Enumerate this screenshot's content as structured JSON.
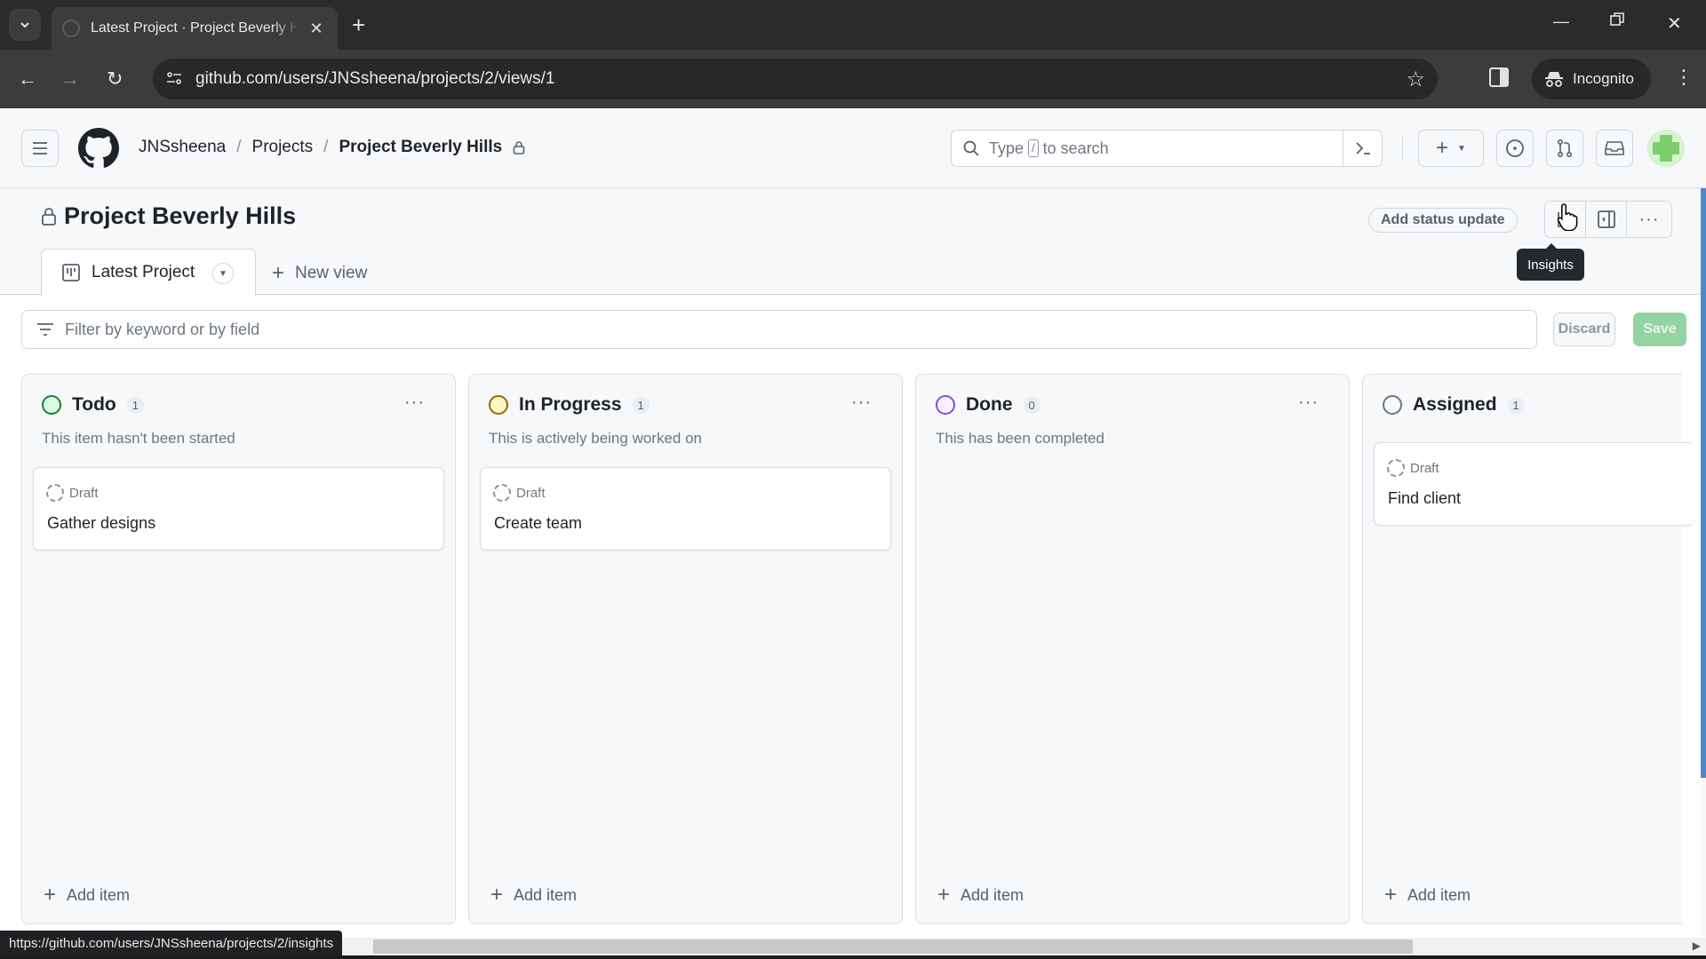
{
  "browser": {
    "tab_title": "Latest Project · Project Beverly Hills",
    "url": "github.com/users/JNSsheena/projects/2/views/1",
    "incognito_label": "Incognito",
    "status_url": "https://github.com/users/JNSsheena/projects/2/insights"
  },
  "header": {
    "breadcrumbs": [
      {
        "label": "JNSsheena"
      },
      {
        "label": "Projects"
      },
      {
        "label": "Project Beverly Hills"
      }
    ],
    "separator": "/",
    "search": {
      "prefix": "Type",
      "key": "/",
      "suffix": "to search"
    },
    "avatar_color": "#9be08e"
  },
  "project": {
    "title": "Project Beverly Hills",
    "status_update_label": "Add status update",
    "tooltip": "Insights",
    "views": [
      {
        "label": "Latest Project"
      }
    ],
    "new_view_label": "New view",
    "filter_placeholder": "Filter by keyword or by field",
    "discard_label": "Discard",
    "save_label": "Save"
  },
  "board": {
    "add_item_label": "Add item",
    "columns": [
      {
        "name": "Todo",
        "count": "1",
        "description": "This item hasn't been started",
        "color": "#1a7f37",
        "items": [
          {
            "status": "Draft",
            "title": "Gather designs"
          }
        ]
      },
      {
        "name": "In Progress",
        "count": "1",
        "description": "This is actively being worked on",
        "color": "#9a6700",
        "items": [
          {
            "status": "Draft",
            "title": "Create team"
          }
        ]
      },
      {
        "name": "Done",
        "count": "0",
        "description": "This has been completed",
        "color": "#8250df",
        "items": []
      },
      {
        "name": "Assigned",
        "count": "1",
        "description": "",
        "color": "#6e7781",
        "items": [
          {
            "status": "Draft",
            "title": "Find client"
          }
        ]
      }
    ]
  }
}
